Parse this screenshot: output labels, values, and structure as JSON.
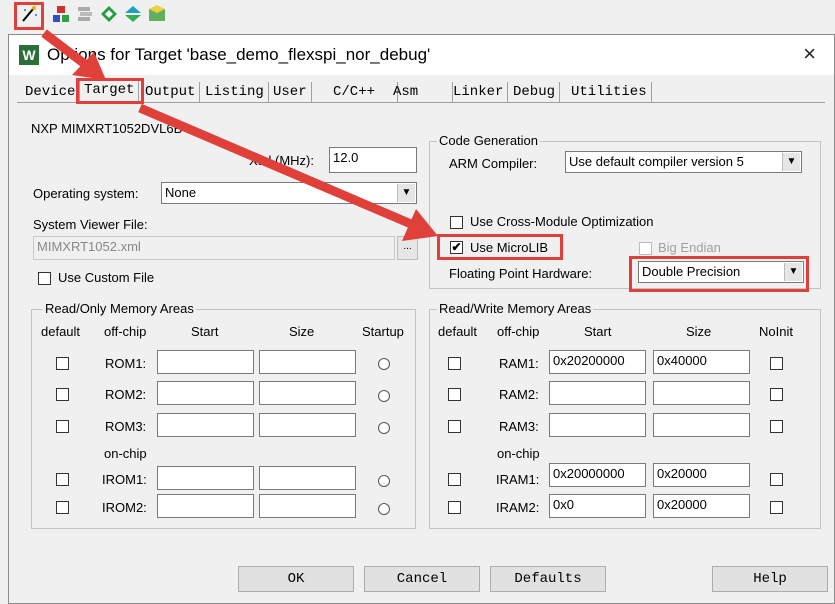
{
  "toolbar": {
    "buttons": [
      {
        "icon": "magic-wand-icon"
      },
      {
        "icon": "component-icon"
      },
      {
        "icon": "stack-icon"
      },
      {
        "icon": "diamond-icon"
      },
      {
        "icon": "branch-icon"
      },
      {
        "icon": "pack-icon"
      }
    ]
  },
  "dialog": {
    "title": "Options for Target 'base_demo_flexspi_nor_debug'",
    "close": "×",
    "tabs": [
      "Device",
      "Target",
      "Output",
      "Listing",
      "User",
      "C/C++",
      "Asm",
      "Linker",
      "Debug",
      "Utilities"
    ],
    "active_tab": "Target"
  },
  "target": {
    "device_name": "NXP MIMXRT1052DVL6B",
    "xtal_label": "Xtal (MHz):",
    "xtal_value": "12.0",
    "os_label": "Operating system:",
    "os_value": "None",
    "sysviewer_label": "System Viewer File:",
    "sysviewer_value": "MIMXRT1052.xml",
    "browse_label": "...",
    "custom_file_label": "Use Custom File"
  },
  "codegen": {
    "title": "Code Generation",
    "compiler_label": "ARM Compiler:",
    "compiler_value": "Use default compiler version 5",
    "cross_module_label": "Use Cross-Module Optimization",
    "cross_module_checked": false,
    "microlib_label": "Use MicroLIB",
    "microlib_checked": true,
    "microlib_mark": "✔",
    "big_endian_label": "Big Endian",
    "fph_label": "Floating Point Hardware:",
    "fph_value": "Double Precision"
  },
  "rom": {
    "title": "Read/Only Memory Areas",
    "headers": {
      "default": "default",
      "offchip": "off-chip",
      "start": "Start",
      "size": "Size",
      "startup": "Startup"
    },
    "onchip_label": "on-chip",
    "rows": [
      {
        "name": "ROM1:",
        "start": "",
        "size": ""
      },
      {
        "name": "ROM2:",
        "start": "",
        "size": ""
      },
      {
        "name": "ROM3:",
        "start": "",
        "size": ""
      },
      {
        "name": "IROM1:",
        "start": "",
        "size": ""
      },
      {
        "name": "IROM2:",
        "start": "",
        "size": ""
      }
    ]
  },
  "ram": {
    "title": "Read/Write Memory Areas",
    "headers": {
      "default": "default",
      "offchip": "off-chip",
      "start": "Start",
      "size": "Size",
      "noinit": "NoInit"
    },
    "onchip_label": "on-chip",
    "rows": [
      {
        "name": "RAM1:",
        "start": "0x20200000",
        "size": "0x40000"
      },
      {
        "name": "RAM2:",
        "start": "",
        "size": ""
      },
      {
        "name": "RAM3:",
        "start": "",
        "size": ""
      },
      {
        "name": "IRAM1:",
        "start": "0x20000000",
        "size": "0x20000"
      },
      {
        "name": "IRAM2:",
        "start": "0x0",
        "size": "0x20000"
      }
    ]
  },
  "buttons": {
    "ok": "OK",
    "cancel": "Cancel",
    "defaults": "Defaults",
    "help": "Help"
  },
  "colors": {
    "annotation": "#e0403a"
  }
}
